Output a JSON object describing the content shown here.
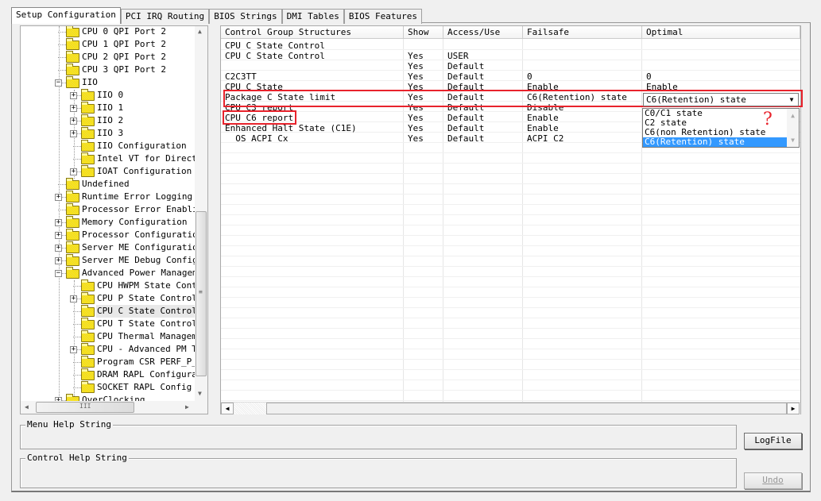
{
  "tabs": [
    {
      "label": "Setup Configuration",
      "active": true
    },
    {
      "label": "PCI IRQ Routing",
      "active": false
    },
    {
      "label": "BIOS Strings",
      "active": false
    },
    {
      "label": "DMI Tables",
      "active": false
    },
    {
      "label": "BIOS Features",
      "active": false
    }
  ],
  "tree": {
    "items": [
      {
        "label": "CPU 0 QPI Port 2",
        "level": 1,
        "expander": "none"
      },
      {
        "label": "CPU 1 QPI Port 2",
        "level": 1,
        "expander": "none"
      },
      {
        "label": "CPU 2 QPI Port 2",
        "level": 1,
        "expander": "none"
      },
      {
        "label": "CPU 3 QPI Port 2",
        "level": 1,
        "expander": "none"
      },
      {
        "label": "IIO",
        "level": 1,
        "expander": "minus"
      },
      {
        "label": "IIO 0",
        "level": 2,
        "expander": "plus"
      },
      {
        "label": "IIO 1",
        "level": 2,
        "expander": "plus"
      },
      {
        "label": "IIO 2",
        "level": 2,
        "expander": "plus"
      },
      {
        "label": "IIO 3",
        "level": 2,
        "expander": "plus"
      },
      {
        "label": "IIO Configuration",
        "level": 2,
        "expander": "none"
      },
      {
        "label": "Intel VT for Directe",
        "level": 2,
        "expander": "none"
      },
      {
        "label": "IOAT Configuration",
        "level": 2,
        "expander": "plus"
      },
      {
        "label": "Undefined",
        "level": 1,
        "expander": "none"
      },
      {
        "label": "Runtime Error Logging",
        "level": 1,
        "expander": "plus"
      },
      {
        "label": "Processor Error Enablin",
        "level": 1,
        "expander": "none"
      },
      {
        "label": "Memory Configuration",
        "level": 1,
        "expander": "plus"
      },
      {
        "label": "Processor Configuration",
        "level": 1,
        "expander": "plus"
      },
      {
        "label": "Server ME Configuration",
        "level": 1,
        "expander": "plus"
      },
      {
        "label": "Server ME Debug Configu",
        "level": 1,
        "expander": "plus"
      },
      {
        "label": "Advanced Power Manageme",
        "level": 1,
        "expander": "minus"
      },
      {
        "label": "CPU HWPM State Contr",
        "level": 2,
        "expander": "none"
      },
      {
        "label": "CPU P State Control",
        "level": 2,
        "expander": "plus"
      },
      {
        "label": "CPU C State Control",
        "level": 2,
        "expander": "none",
        "selected": true
      },
      {
        "label": "CPU T State Control",
        "level": 2,
        "expander": "none"
      },
      {
        "label": "CPU Thermal Manageme",
        "level": 2,
        "expander": "none"
      },
      {
        "label": "CPU - Advanced PM Tu",
        "level": 2,
        "expander": "plus"
      },
      {
        "label": "Program CSR PERF_P_L",
        "level": 2,
        "expander": "none"
      },
      {
        "label": "DRAM RAPL Configurat",
        "level": 2,
        "expander": "none"
      },
      {
        "label": "SOCKET RAPL Config",
        "level": 2,
        "expander": "none"
      },
      {
        "label": "OverClocking",
        "level": 1,
        "expander": "plus"
      }
    ]
  },
  "table": {
    "columns": [
      "Control Group Structures",
      "Show",
      "Access/Use",
      "Failsafe",
      "Optimal"
    ],
    "rows": [
      [
        "CPU C State Control",
        "",
        "",
        "",
        ""
      ],
      [
        "CPU C State Control",
        "Yes",
        "USER",
        "",
        ""
      ],
      [
        "",
        "Yes",
        "Default",
        "",
        ""
      ],
      [
        "C2C3TT",
        "Yes",
        "Default",
        "0",
        "0"
      ],
      [
        "CPU C State",
        "Yes",
        "Default",
        "Enable",
        "Enable"
      ],
      [
        "Package C State limit",
        "Yes",
        "Default",
        "C6(Retention) state",
        ""
      ],
      [
        "CPU C3 report",
        "Yes",
        "Default",
        "Disable",
        ""
      ],
      [
        "CPU C6 report",
        "Yes",
        "Default",
        "Enable",
        ""
      ],
      [
        "Enhanced Halt State (C1E)",
        "Yes",
        "Default",
        "Enable",
        ""
      ],
      [
        "  OS ACPI Cx",
        "Yes",
        "Default",
        "ACPI C2",
        ""
      ]
    ]
  },
  "dropdown": {
    "value": "C6(Retention) state",
    "options": [
      "C0/C1 state",
      "C2 state",
      "C6(non Retention) state",
      "C6(Retention) state"
    ],
    "selected_index": 3
  },
  "annotation": {
    "mark": "?",
    "color": "#e8232c"
  },
  "menu_help": {
    "label": "Menu Help String"
  },
  "control_help": {
    "label": "Control Help String"
  },
  "buttons": {
    "logfile": "LogFile",
    "undo": "Undo"
  },
  "colors": {
    "selection": "#3399ff",
    "highlight_box": "#e8232c"
  }
}
